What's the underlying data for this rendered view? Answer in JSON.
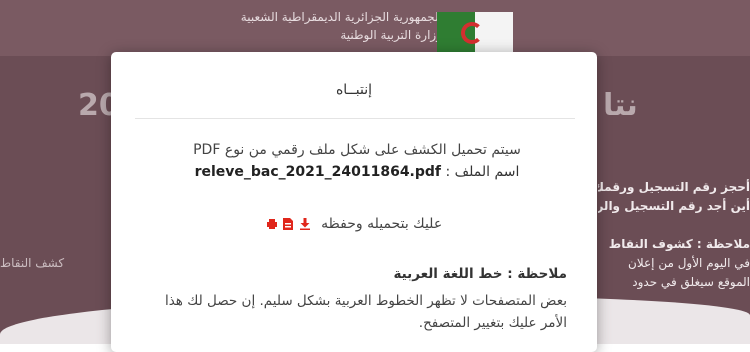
{
  "header": {
    "country_name": "الجمهورية الجزائرية الديمقراطية الشعبية",
    "ministry_name": "وزارة التربية الوطنية"
  },
  "background": {
    "title_left_fragment": "20",
    "title_right_fragment": "نتا",
    "right_lines": [
      "أحجز رقم التسجيل ورقمك",
      "أين أجد رقم التسجيل والر",
      "",
      "ملاحظة : كشوف النقاط",
      "في اليوم الأول من إعلان",
      "الموقع سيغلق في حدود"
    ],
    "left_lines": [
      "",
      "",
      "",
      "",
      "كشف النقاط",
      ""
    ]
  },
  "modal": {
    "title": "إنتبــاه",
    "message_line1": "سيتم تحميل الكشف على شكل ملف رقمي من نوع PDF",
    "file_label": "اسم الملف :",
    "file_name": "releve_bac_2021_24011864.pdf",
    "download_instruction": "عليك بتحميله وحفظه",
    "note_title": "ملاحظة : خط اللغة العربية",
    "note_text": "بعض المتصفحات لا تظهر الخطوط العربية بشكل سليم. إن حصل لك هذا الأمر عليك بتغيير المتصفح."
  },
  "colors": {
    "background": "#6b4d55",
    "icon_red": "#e0261b"
  },
  "icons": [
    "download-icon",
    "pdf-file-icon",
    "print-icon"
  ]
}
